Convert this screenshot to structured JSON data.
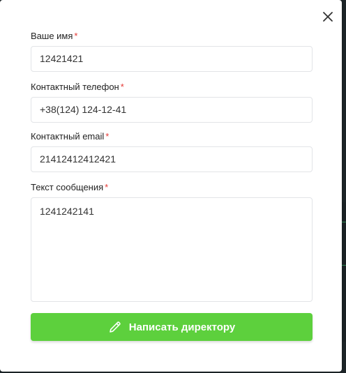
{
  "form": {
    "name": {
      "label": "Ваше имя",
      "required_mark": "*",
      "value": "12421421"
    },
    "phone": {
      "label": "Контактный телефон",
      "required_mark": "*",
      "value": "+38(124) 124-12-41"
    },
    "email": {
      "label": "Контактный email",
      "required_mark": "*",
      "value": "21412412412421"
    },
    "message": {
      "label": "Текст сообщения",
      "required_mark": "*",
      "value": "1241242141"
    },
    "submit": {
      "label": "Написать директору",
      "icon": "pencil-icon"
    },
    "close_icon": "close-icon"
  },
  "colors": {
    "accent": "#5dd03d",
    "required": "#e53935",
    "border": "#e2e4e7"
  }
}
